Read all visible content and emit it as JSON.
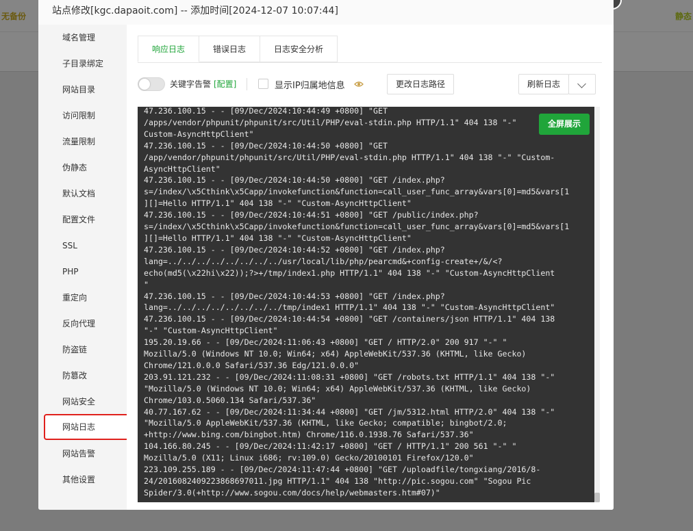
{
  "background": {
    "left_text": "无备份",
    "right_text": "静态"
  },
  "modal": {
    "title": "站点修改[kgc.dapaoit.com] -- 添加时间[2024-12-07 10:07:44]"
  },
  "sidebar": {
    "items": [
      {
        "label": "域名管理"
      },
      {
        "label": "子目录绑定"
      },
      {
        "label": "网站目录"
      },
      {
        "label": "访问限制"
      },
      {
        "label": "流量限制"
      },
      {
        "label": "伪静态"
      },
      {
        "label": "默认文档"
      },
      {
        "label": "配置文件"
      },
      {
        "label": "SSL"
      },
      {
        "label": "PHP"
      },
      {
        "label": "重定向"
      },
      {
        "label": "反向代理"
      },
      {
        "label": "防盗链"
      },
      {
        "label": "防篡改"
      },
      {
        "label": "网站安全"
      },
      {
        "label": "网站日志"
      },
      {
        "label": "网站告警"
      },
      {
        "label": "其他设置"
      }
    ],
    "active_index": 15
  },
  "tabs": [
    {
      "label": "响应日志"
    },
    {
      "label": "错误日志"
    },
    {
      "label": "日志安全分析"
    }
  ],
  "toolbar": {
    "keyword_alert_label": "关键字告警",
    "keyword_config_label": "[配置]",
    "show_ip_label": "显示IP归属地信息",
    "change_path_label": "更改日志路径",
    "refresh_label": "刷新日志"
  },
  "log": {
    "fullscreen_label": "全屏展示",
    "lines": [
      "47.236.100.15 - - [09/Dec/2024:10:44:49 +0800] \"GET",
      "/apps/vendor/phpunit/phpunit/src/Util/PHP/eval-stdin.php HTTP/1.1\" 404 138 \"-\"",
      "Custom-AsyncHttpClient\"",
      "47.236.100.15 - - [09/Dec/2024:10:44:50 +0800] \"GET",
      "/app/vendor/phpunit/phpunit/src/Util/PHP/eval-stdin.php HTTP/1.1\" 404 138 \"-\" \"Custom-",
      "AsyncHttpClient\"",
      "47.236.100.15 - - [09/Dec/2024:10:44:50 +0800] \"GET /index.php?",
      "s=/index/\\x5Cthink\\x5Capp/invokefunction&function=call_user_func_array&vars[0]=md5&vars[1",
      "][]=Hello HTTP/1.1\" 404 138 \"-\" \"Custom-AsyncHttpClient\"",
      "47.236.100.15 - - [09/Dec/2024:10:44:51 +0800] \"GET /public/index.php?",
      "s=/index/\\x5Cthink\\x5Capp/invokefunction&function=call_user_func_array&vars[0]=md5&vars[1",
      "][]=Hello HTTP/1.1\" 404 138 \"-\" \"Custom-AsyncHttpClient\"",
      "47.236.100.15 - - [09/Dec/2024:10:44:52 +0800] \"GET /index.php?",
      "lang=../../../../../../../../usr/local/lib/php/pearcmd&+config-create+/&/<?",
      "echo(md5(\\x22hi\\x22));?>+/tmp/index1.php HTTP/1.1\" 404 138 \"-\" \"Custom-AsyncHttpClient",
      "\"",
      "47.236.100.15 - - [09/Dec/2024:10:44:53 +0800] \"GET /index.php?",
      "lang=../../../../../../../../tmp/index1 HTTP/1.1\" 404 138 \"-\" \"Custom-AsyncHttpClient\"",
      "47.236.100.15 - - [09/Dec/2024:10:44:54 +0800] \"GET /containers/json HTTP/1.1\" 404 138",
      "\"-\" \"Custom-AsyncHttpClient\"",
      "195.20.19.66 - - [09/Dec/2024:11:06:43 +0800] \"GET / HTTP/2.0\" 200 917 \"-\" \"",
      "Mozilla/5.0 (Windows NT 10.0; Win64; x64) AppleWebKit/537.36 (KHTML, like Gecko)",
      "Chrome/121.0.0.0 Safari/537.36 Edg/121.0.0.0\"",
      "203.91.121.232 - - [09/Dec/2024:11:08:31 +0800] \"GET /robots.txt HTTP/1.1\" 404 138 \"-\"",
      "\"Mozilla/5.0 (Windows NT 10.0; Win64; x64) AppleWebKit/537.36 (KHTML, like Gecko)",
      "Chrome/103.0.5060.134 Safari/537.36\"",
      "40.77.167.62 - - [09/Dec/2024:11:34:44 +0800] \"GET /jm/5312.html HTTP/2.0\" 404 138 \"-\"",
      "\"Mozilla/5.0 AppleWebKit/537.36 (KHTML, like Gecko; compatible; bingbot/2.0;",
      "+http://www.bing.com/bingbot.htm) Chrome/116.0.1938.76 Safari/537.36\"",
      "104.166.80.245 - - [09/Dec/2024:11:42:17 +0800] \"GET / HTTP/1.1\" 200 561 \"-\" \"",
      "Mozilla/5.0 (X11; Linux i686; rv:109.0) Gecko/20100101 Firefox/120.0\"",
      "223.109.255.189 - - [09/Dec/2024:11:47:44 +0800] \"GET /uploadfile/tongxiang/2016/8-",
      "24/2016082409223868697011.jpg HTTP/1.1\" 404 138 \"http://pic.sogou.com\" \"Sogou Pic",
      "Spider/3.0(+http://www.sogou.com/docs/help/webmasters.htm#07)\""
    ]
  },
  "colors": {
    "accent": "#20a53a",
    "highlight_border": "#e0201c",
    "log_bg": "#333333",
    "log_text": "#e8e8e8"
  }
}
